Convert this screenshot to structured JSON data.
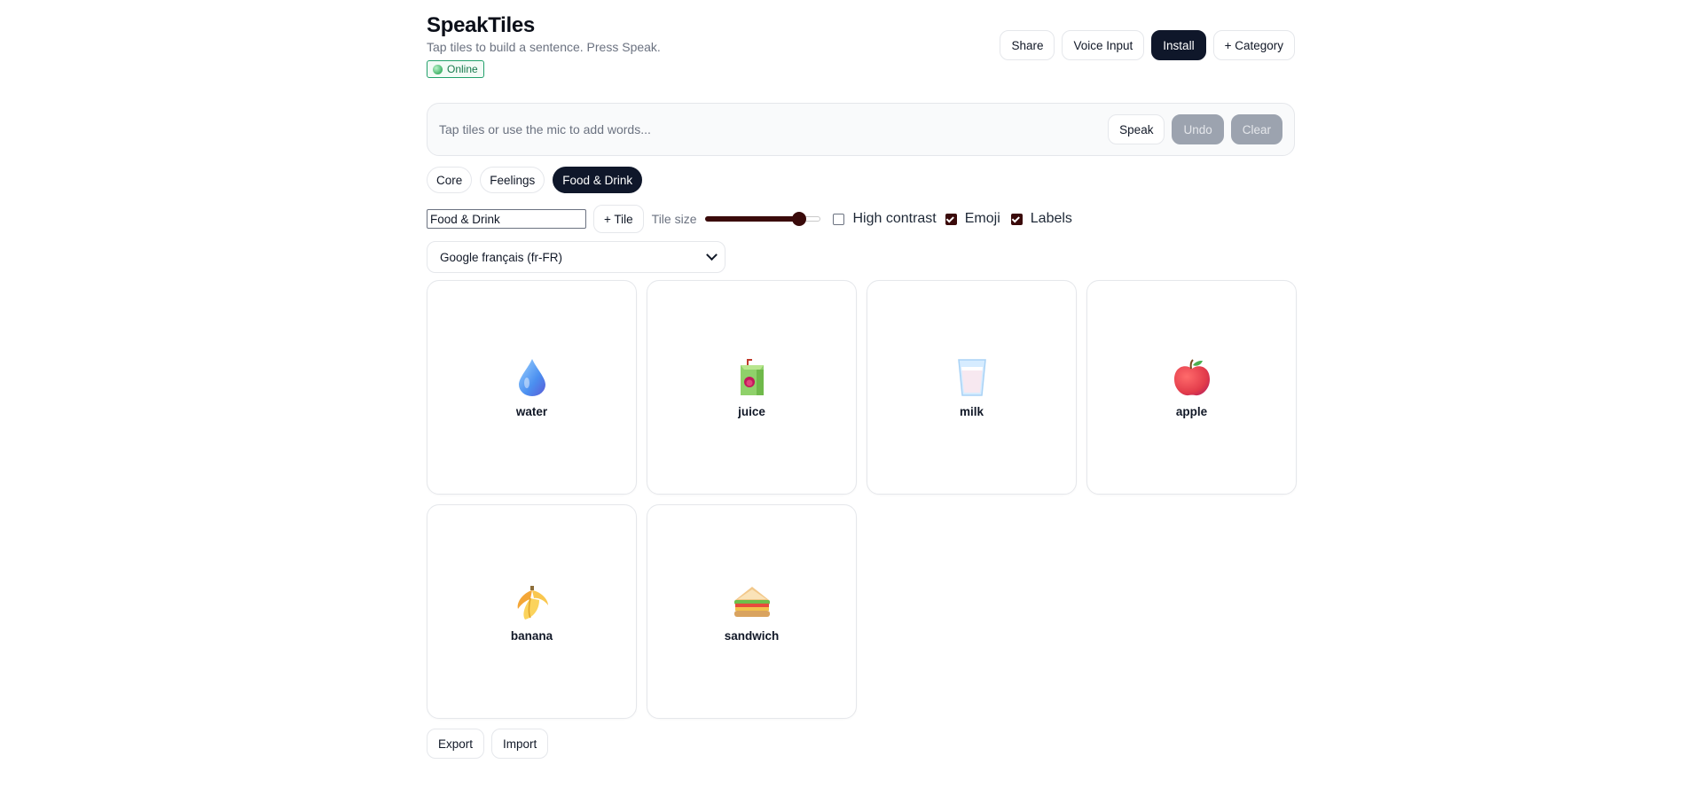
{
  "app": {
    "title": "SpeakTiles",
    "subtitle": "Tap tiles to build a sentence. Press Speak.",
    "status": "Online"
  },
  "header_actions": {
    "share": "Share",
    "voice_input": "Voice Input",
    "install": "Install",
    "add_category": "+ Category"
  },
  "sentence": {
    "placeholder": "Tap tiles or use the mic to add words...",
    "speak": "Speak",
    "undo": "Undo",
    "clear": "Clear"
  },
  "categories": [
    {
      "label": "Core",
      "active": false
    },
    {
      "label": "Feelings",
      "active": false
    },
    {
      "label": "Food & Drink",
      "active": true
    }
  ],
  "controls": {
    "category_name_value": "Food & Drink",
    "add_tile": "+ Tile",
    "tile_size_label": "Tile size",
    "tile_size_fraction": 0.81,
    "high_contrast_label": "High contrast",
    "high_contrast_checked": false,
    "emoji_label": "Emoji",
    "emoji_checked": true,
    "labels_label": "Labels",
    "labels_checked": true
  },
  "voice": {
    "selected": "Google français (fr-FR)"
  },
  "tiles": [
    {
      "label": "water",
      "icon": "water-drop-icon"
    },
    {
      "label": "juice",
      "icon": "juice-box-icon"
    },
    {
      "label": "milk",
      "icon": "milk-glass-icon"
    },
    {
      "label": "apple",
      "icon": "apple-icon"
    },
    {
      "label": "banana",
      "icon": "banana-icon"
    },
    {
      "label": "sandwich",
      "icon": "sandwich-icon"
    }
  ],
  "footer": {
    "export": "Export",
    "import": "Import"
  },
  "colors": {
    "accent_dark": "#0f172a",
    "online_green": "#22a06b",
    "slider_fill": "#3a0a0a"
  }
}
